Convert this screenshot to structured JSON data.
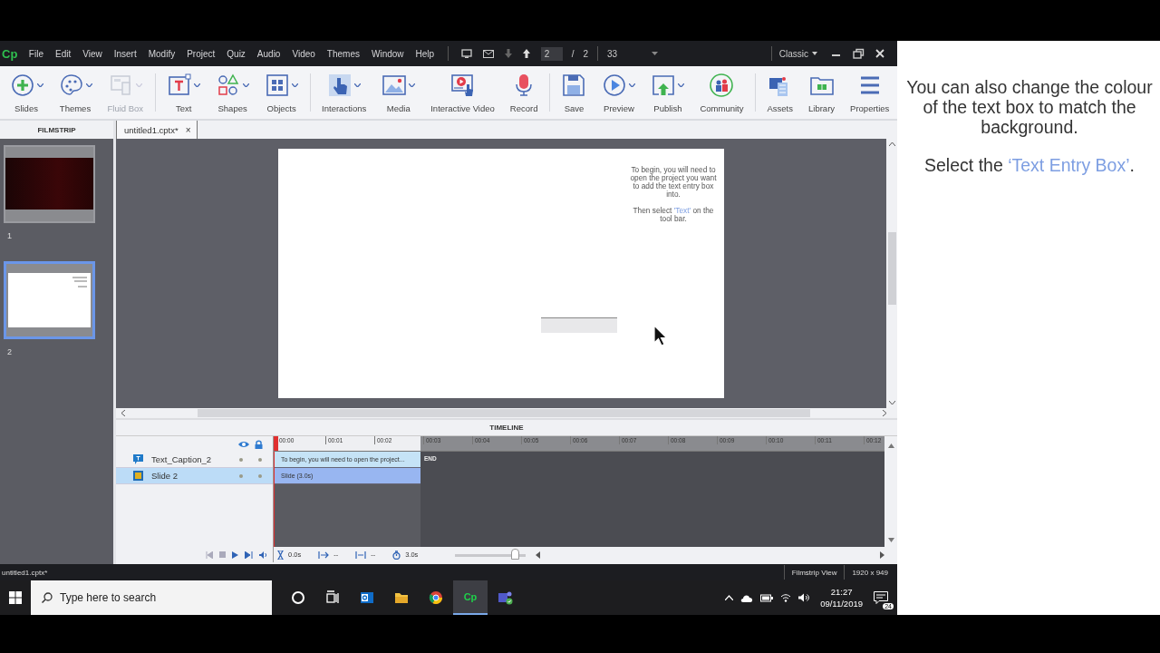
{
  "app": {
    "logo": "Cp",
    "menu": [
      "File",
      "Edit",
      "View",
      "Insert",
      "Modify",
      "Project",
      "Quiz",
      "Audio",
      "Video",
      "Themes",
      "Window",
      "Help"
    ],
    "slide_nav": {
      "current": "2",
      "separator": "/",
      "total": "2",
      "zoom": "33"
    },
    "workspace": "Classic",
    "toolbar": [
      {
        "kind": "plus",
        "label": "Slides",
        "dropdown": true,
        "disabled": false
      },
      {
        "kind": "palette",
        "label": "Themes",
        "dropdown": true,
        "disabled": false
      },
      {
        "kind": "fluid",
        "label": "Fluid Box",
        "dropdown": true,
        "disabled": true
      },
      {
        "kind": "text",
        "label": "Text",
        "dropdown": true,
        "disabled": false,
        "group_start": true
      },
      {
        "kind": "shapes",
        "label": "Shapes",
        "dropdown": true,
        "disabled": false
      },
      {
        "kind": "objects",
        "label": "Objects",
        "dropdown": true,
        "disabled": false
      },
      {
        "kind": "hand",
        "label": "Interactions",
        "dropdown": true,
        "disabled": false,
        "group_start": true
      },
      {
        "kind": "image",
        "label": "Media",
        "dropdown": true,
        "disabled": false
      },
      {
        "kind": "video",
        "label": "Interactive Video",
        "dropdown": false,
        "disabled": false
      },
      {
        "kind": "mic",
        "label": "Record",
        "dropdown": false,
        "disabled": false
      },
      {
        "kind": "save",
        "label": "Save",
        "dropdown": false,
        "disabled": false,
        "group_start": true
      },
      {
        "kind": "play",
        "label": "Preview",
        "dropdown": true,
        "disabled": false
      },
      {
        "kind": "publish",
        "label": "Publish",
        "dropdown": true,
        "disabled": false
      },
      {
        "kind": "community",
        "label": "Community",
        "dropdown": false,
        "disabled": false
      },
      {
        "kind": "assets",
        "label": "Assets",
        "dropdown": false,
        "disabled": false,
        "group_start": true
      },
      {
        "kind": "library",
        "label": "Library",
        "dropdown": false,
        "disabled": false
      },
      {
        "kind": "properties",
        "label": "Properties",
        "dropdown": false,
        "disabled": false
      }
    ],
    "filmstrip": {
      "title": "FILMSTRIP",
      "slides": [
        {
          "number": "1",
          "kind": "dark",
          "selected": false
        },
        {
          "number": "2",
          "kind": "light",
          "selected": true
        }
      ]
    },
    "document_tab": {
      "title": "untitled1.cptx*",
      "close": "×"
    },
    "slide": {
      "caption": [
        "To begin, you will need to open the project you want to add the text entry box into.",
        {
          "before": "Then select ",
          "highlight": "'Text'",
          "after": " on the tool bar."
        }
      ]
    },
    "timeline": {
      "title": "TIMELINE",
      "ruler": [
        "00:00",
        "00:01",
        "00:02",
        "00:03",
        "00:04",
        "00:05",
        "00:06",
        "00:07",
        "00:08",
        "00:09",
        "00:10",
        "00:11",
        "00:12"
      ],
      "end_label": "END",
      "layers": [
        {
          "kind": "caption",
          "name": "Text_Caption_2",
          "bar": "To begin, you will need to open the project...",
          "selected": false
        },
        {
          "kind": "slide",
          "name": "Slide 2",
          "bar": "Slide (3.0s)",
          "selected": true
        }
      ],
      "readings": {
        "start": "0.0s",
        "in": "--",
        "out": "--",
        "duration": "3.0s"
      },
      "zoom": {
        "level": 0.85
      }
    },
    "status_bar": {
      "file": "untitled1.cptx*",
      "view": "Filmstrip View",
      "size": "1920 x 949"
    }
  },
  "taskbar": {
    "search": {
      "placeholder": "Type here to search"
    },
    "time": "21:27",
    "date": "09/11/2019",
    "notifications": "24",
    "active_app": "Cp"
  },
  "instructions": [
    "You can also change the colour of the text box to match the background.",
    {
      "before": "Select the ",
      "highlight": "‘Text Entry Box’",
      "after": "."
    }
  ]
}
